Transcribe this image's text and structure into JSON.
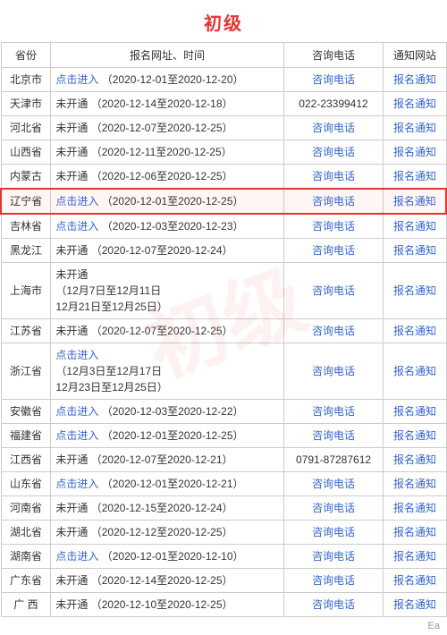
{
  "title": "初级",
  "headers": [
    "省份",
    "报名网址、时间",
    "咨询电话",
    "通知网站"
  ],
  "rows": [
    {
      "province": "北京市",
      "register_html": "link",
      "register_link_text": "点击进入",
      "register_date": "（2020-12-01至2020-12-20）",
      "phone": "咨询电话",
      "phone_link": true,
      "notify": "报名通知",
      "notify_link": true,
      "highlighted": false
    },
    {
      "province": "天津市",
      "register_html": "text",
      "register_text": "未开通",
      "register_date": "（2020-12-14至2020-12-18）",
      "phone": "022-23399412",
      "phone_link": false,
      "notify": "报名通知",
      "notify_link": true,
      "highlighted": false
    },
    {
      "province": "河北省",
      "register_html": "text",
      "register_text": "未开通",
      "register_date": "（2020-12-07至2020-12-25）",
      "phone": "咨询电话",
      "phone_link": true,
      "notify": "报名通知",
      "notify_link": true,
      "highlighted": false
    },
    {
      "province": "山西省",
      "register_html": "text",
      "register_text": "未开通",
      "register_date": "（2020-12-11至2020-12-25）",
      "phone": "咨询电话",
      "phone_link": true,
      "notify": "报名通知",
      "notify_link": true,
      "highlighted": false
    },
    {
      "province": "内蒙古",
      "register_html": "text",
      "register_text": "未开通",
      "register_date": "（2020-12-06至2020-12-25）",
      "phone": "咨询电话",
      "phone_link": true,
      "notify": "报名通知",
      "notify_link": true,
      "highlighted": false
    },
    {
      "province": "辽宁省",
      "register_html": "link",
      "register_link_text": "点击进入",
      "register_date": "（2020-12-01至2020-12-25）",
      "phone": "咨询电话",
      "phone_link": true,
      "notify": "报名通知",
      "notify_link": true,
      "highlighted": true
    },
    {
      "province": "吉林省",
      "register_html": "link",
      "register_link_text": "点击进入",
      "register_date": "（2020-12-03至2020-12-23）",
      "phone": "咨询电话",
      "phone_link": true,
      "notify": "报名通知",
      "notify_link": true,
      "highlighted": false
    },
    {
      "province": "黑龙江",
      "register_html": "text",
      "register_text": "未开通",
      "register_date": "（2020-12-07至2020-12-24）",
      "phone": "咨询电话",
      "phone_link": true,
      "notify": "报名通知",
      "notify_link": true,
      "highlighted": false
    },
    {
      "province": "上海市",
      "register_html": "text_multiline",
      "register_text": "未开通",
      "register_date": "（12月7日至12月11日\n12月21日至12月25日）",
      "phone": "咨询电话",
      "phone_link": true,
      "notify": "报名通知",
      "notify_link": true,
      "highlighted": false
    },
    {
      "province": "江苏省",
      "register_html": "text",
      "register_text": "未开通",
      "register_date": "（2020-12-07至2020-12-25）",
      "phone": "咨询电话",
      "phone_link": true,
      "notify": "报名通知",
      "notify_link": true,
      "highlighted": false
    },
    {
      "province": "浙江省",
      "register_html": "link_multiline",
      "register_link_text": "点击进入",
      "register_date": "（12月3日至12月17日\n12月23日至12月25日）",
      "phone": "咨询电话",
      "phone_link": true,
      "notify": "报名通知",
      "notify_link": true,
      "highlighted": false
    },
    {
      "province": "安徽省",
      "register_html": "link",
      "register_link_text": "点击进入",
      "register_date": "（2020-12-03至2020-12-22）",
      "phone": "咨询电话",
      "phone_link": true,
      "notify": "报名通知",
      "notify_link": true,
      "highlighted": false
    },
    {
      "province": "福建省",
      "register_html": "link",
      "register_link_text": "点击进入",
      "register_date": "（2020-12-01至2020-12-25）",
      "phone": "咨询电话",
      "phone_link": true,
      "notify": "报名通知",
      "notify_link": true,
      "highlighted": false
    },
    {
      "province": "江西省",
      "register_html": "text",
      "register_text": "未开通",
      "register_date": "（2020-12-07至2020-12-21）",
      "phone": "0791-87287612",
      "phone_link": false,
      "notify": "报名通知",
      "notify_link": true,
      "highlighted": false
    },
    {
      "province": "山东省",
      "register_html": "link",
      "register_link_text": "点击进入",
      "register_date": "（2020-12-01至2020-12-21）",
      "phone": "咨询电话",
      "phone_link": true,
      "notify": "报名通知",
      "notify_link": true,
      "highlighted": false
    },
    {
      "province": "河南省",
      "register_html": "text",
      "register_text": "未开通",
      "register_date": "（2020-12-15至2020-12-24）",
      "phone": "咨询电话",
      "phone_link": true,
      "notify": "报名通知",
      "notify_link": true,
      "highlighted": false
    },
    {
      "province": "湖北省",
      "register_html": "text",
      "register_text": "未开通",
      "register_date": "（2020-12-12至2020-12-25）",
      "phone": "咨询电话",
      "phone_link": true,
      "notify": "报名通知",
      "notify_link": true,
      "highlighted": false
    },
    {
      "province": "湖南省",
      "register_html": "link",
      "register_link_text": "点击进入",
      "register_date": "（2020-12-01至2020-12-10）",
      "phone": "咨询电话",
      "phone_link": true,
      "notify": "报名通知",
      "notify_link": true,
      "highlighted": false
    },
    {
      "province": "广东省",
      "register_html": "text",
      "register_text": "未开通",
      "register_date": "（2020-12-14至2020-12-25）",
      "phone": "咨询电话",
      "phone_link": true,
      "notify": "报名通知",
      "notify_link": true,
      "highlighted": false
    },
    {
      "province": "广 西",
      "register_html": "text",
      "register_text": "未开通",
      "register_date": "（2020-12-10至2020-12-25）",
      "phone": "咨询电话",
      "phone_link": true,
      "notify": "报名通知",
      "notify_link": true,
      "highlighted": false
    }
  ],
  "footer": "Ea",
  "watermark": "初级"
}
